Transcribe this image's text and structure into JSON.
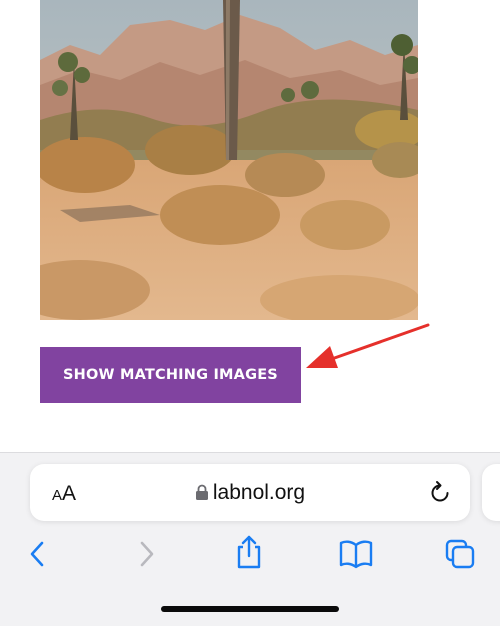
{
  "page": {
    "action_button_label": "SHOW MATCHING IMAGES"
  },
  "browser": {
    "text_size_label_small": "A",
    "text_size_label_big": "A",
    "url": "labnol.org",
    "icons": {
      "lock": "lock-icon",
      "reload": "reload-icon",
      "back": "chevron-left-icon",
      "forward": "chevron-right-icon",
      "share": "share-icon",
      "bookmarks": "book-icon",
      "tabs": "tabs-icon"
    }
  },
  "colors": {
    "button_bg": "#8143a0",
    "arrow": "#e5302b",
    "ios_blue": "#1a7df2",
    "disabled": "#b9b9be"
  }
}
